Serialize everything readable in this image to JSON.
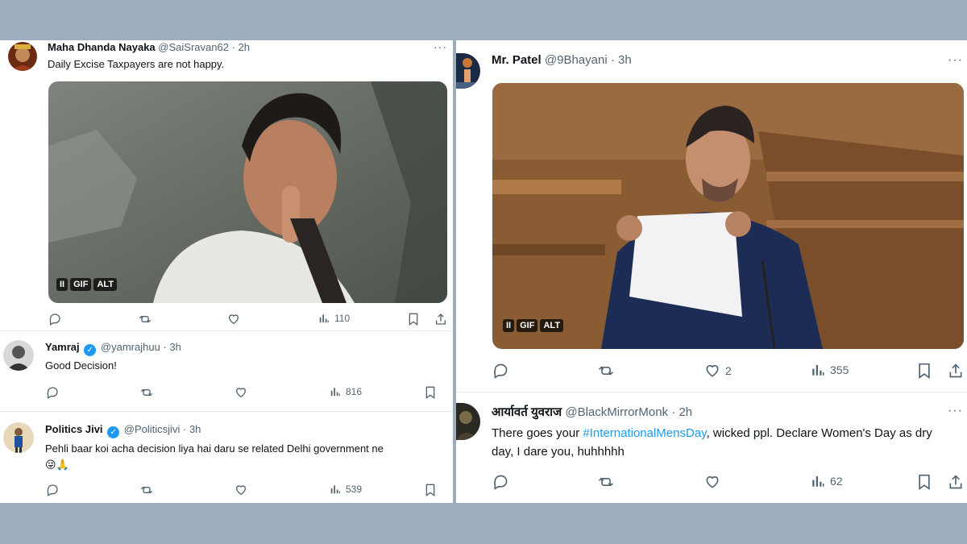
{
  "left_tweets": [
    {
      "name": "Maha Dhanda Nayaka",
      "handle": "@SaiSravan62",
      "time": "2h",
      "text": "Daily Excise Taxpayers are not happy.",
      "media_badges": [
        "II",
        "GIF",
        "ALT"
      ],
      "views": "110"
    },
    {
      "name": "Yamraj",
      "handle": "@yamrajhuu",
      "time": "3h",
      "text": "Good Decision!",
      "views": "816"
    },
    {
      "name": "Politics Jivi",
      "handle": "@Politicsjivi",
      "time": "3h",
      "text": "Pehli baar koi acha decision liya hai daru se related Delhi government ne",
      "emoji": "😜🙏",
      "views": "539"
    }
  ],
  "right_tweets": [
    {
      "name": "Mr. Patel",
      "handle": "@9Bhayani",
      "time": "3h",
      "media_badges": [
        "II",
        "GIF",
        "ALT"
      ],
      "likes": "2",
      "views": "355"
    },
    {
      "name": "आर्यावर्त युवराज",
      "handle": "@BlackMirrorMonk",
      "time": "2h",
      "text_before": "There goes your ",
      "hashtag": "#InternationalMensDay",
      "text_after": ", wicked ppl. Declare Women's Day as dry day, I dare you, huhhhhh",
      "views": "62"
    }
  ],
  "separators": {
    "dot": "·",
    "more": "···"
  },
  "colors": {
    "background": "#9cadc0",
    "accent": "#1d9bf0",
    "muted": "#536471"
  }
}
